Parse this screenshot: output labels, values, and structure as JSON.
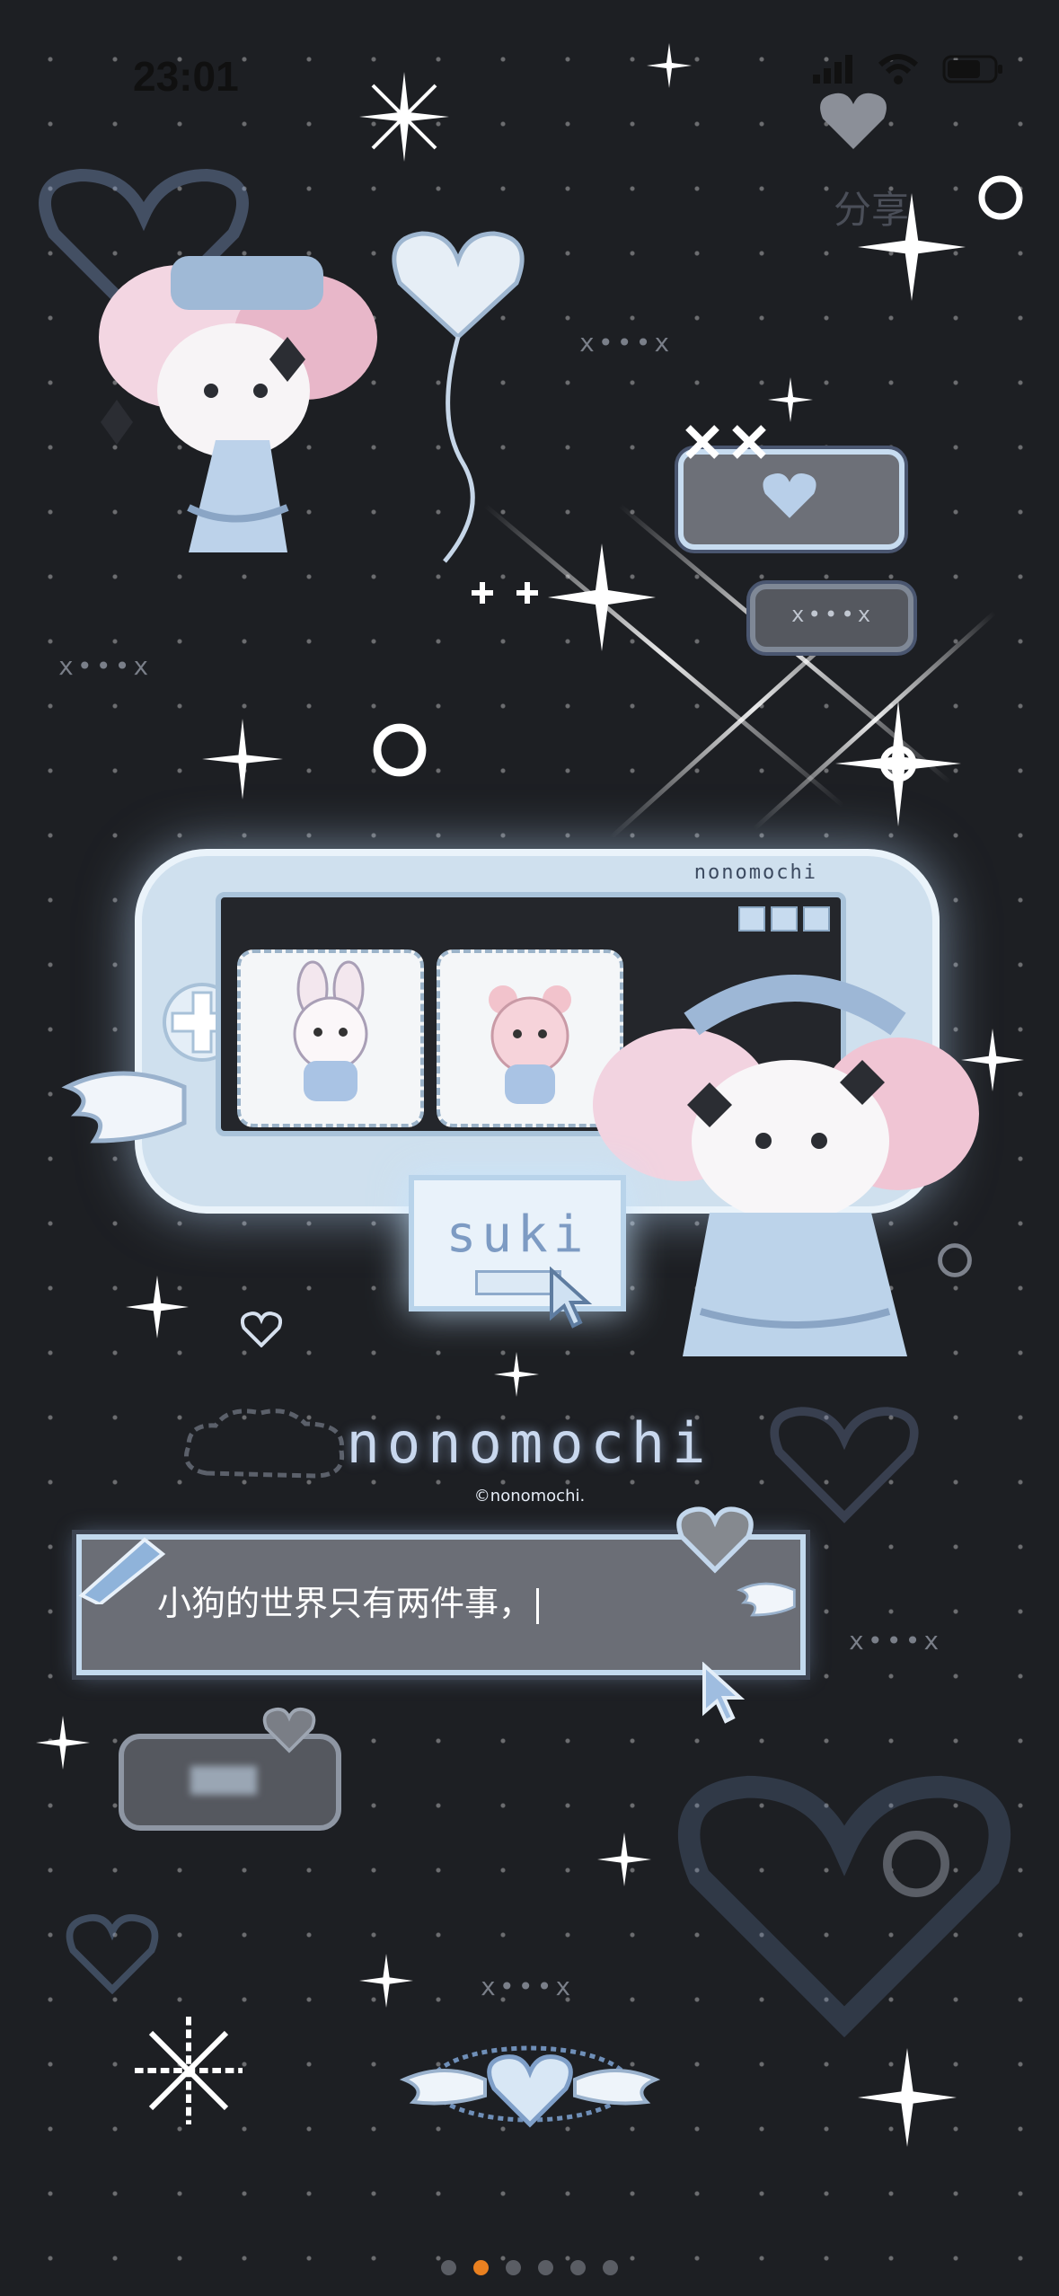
{
  "status_bar": {
    "time": "23:01",
    "icons": [
      "signal-icon",
      "wifi-icon",
      "battery-icon"
    ]
  },
  "header": {
    "share_label": "分享",
    "share_icon": "share-ring-icon"
  },
  "artwork": {
    "brand_small": "nonomochi",
    "popup_text": "suki",
    "brand_name": "nonomochi",
    "copyright": "©nonomochi.",
    "decor_text": "x•••x",
    "message": "小狗的世界只有两件事，"
  },
  "pager": {
    "count": 6,
    "active_index": 1
  },
  "colors": {
    "background": "#1d1f23",
    "accent": "#c7dcf0",
    "pager_active": "#e98020"
  }
}
